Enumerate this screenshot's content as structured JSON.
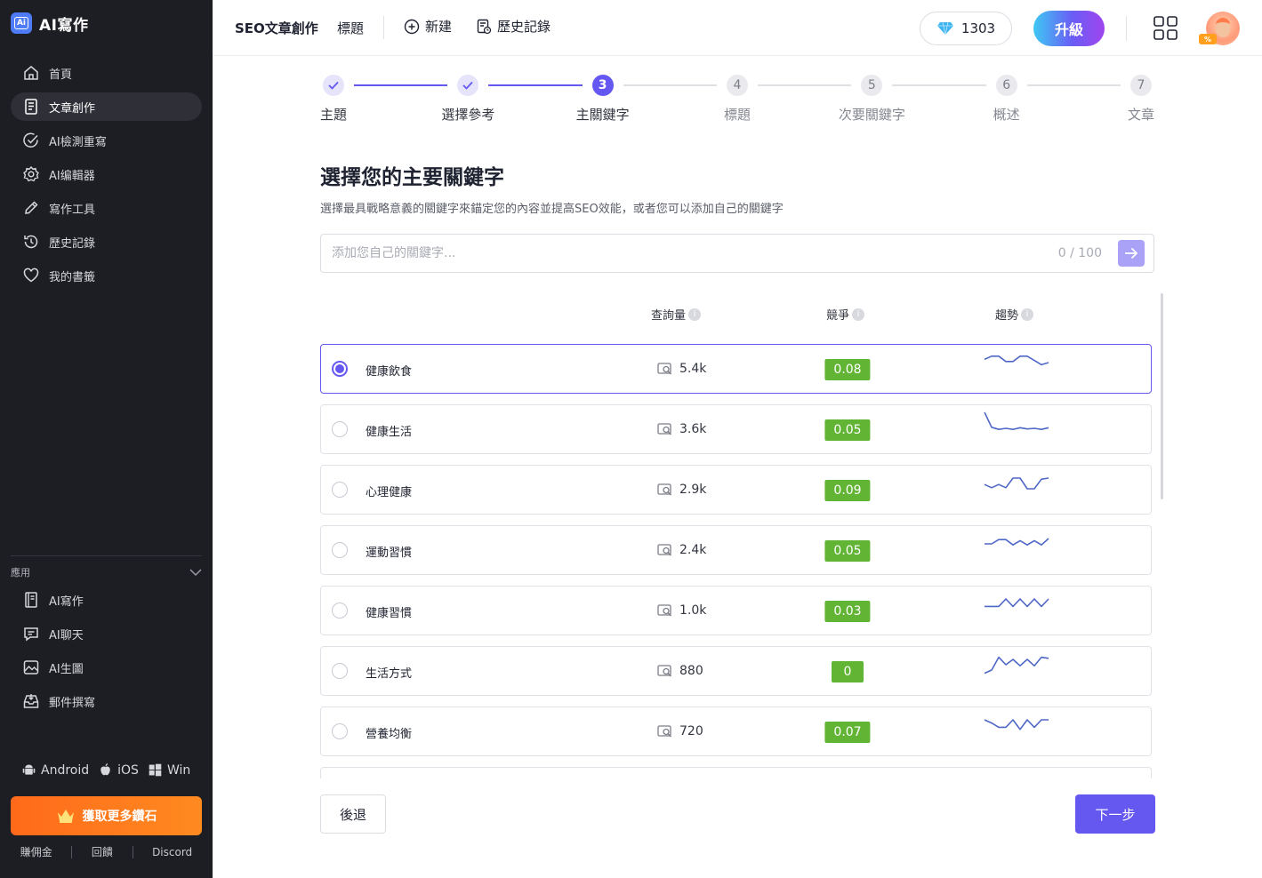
{
  "app": {
    "logo_text": "AI寫作",
    "logo_mark": "Ai"
  },
  "sidebar": {
    "items": [
      {
        "label": "首頁",
        "icon": "home-icon"
      },
      {
        "label": "文章創作",
        "icon": "document-icon",
        "active": true
      },
      {
        "label": "AI檢測重寫",
        "icon": "check-circle-icon"
      },
      {
        "label": "AI编輯器",
        "icon": "gear-icon"
      },
      {
        "label": "寫作工具",
        "icon": "pencil-icon"
      },
      {
        "label": "歷史記錄",
        "icon": "history-icon"
      },
      {
        "label": "我的書籤",
        "icon": "heart-icon"
      }
    ],
    "apps_title": "應用",
    "apps": [
      {
        "label": "AI寫作",
        "icon": "notebook-icon"
      },
      {
        "label": "AI聊天",
        "icon": "chat-icon"
      },
      {
        "label": "AI生圖",
        "icon": "image-icon"
      },
      {
        "label": "郵件撰寫",
        "icon": "inbox-icon"
      }
    ],
    "platforms": [
      "Android",
      "iOS",
      "Win"
    ],
    "get_gems_label": "獲取更多鑽石",
    "footer_links": [
      "賺佣金",
      "回饋",
      "Discord"
    ]
  },
  "topbar": {
    "title": "SEO文章創作",
    "subtitle": "標題",
    "new_label": "新建",
    "history_label": "歷史記錄",
    "gems": "1303",
    "upgrade_label": "升級",
    "avatar_badge": "%"
  },
  "stepper": {
    "steps": [
      {
        "num": "1",
        "label": "主題",
        "state": "done"
      },
      {
        "num": "2",
        "label": "選擇參考",
        "state": "done"
      },
      {
        "num": "3",
        "label": "主關鍵字",
        "state": "current"
      },
      {
        "num": "4",
        "label": "標題",
        "state": "todo"
      },
      {
        "num": "5",
        "label": "次要關鍵字",
        "state": "todo"
      },
      {
        "num": "6",
        "label": "概述",
        "state": "todo"
      },
      {
        "num": "7",
        "label": "文章",
        "state": "todo"
      }
    ]
  },
  "main": {
    "heading": "選擇您的主要關鍵字",
    "subheading": "選擇最具戰略意義的關鍵字來錨定您的內容並提高SEO效能，或者您可以添加自己的關鍵字",
    "input_placeholder": "添加您自己的關鍵字...",
    "input_value": "",
    "char_count": "0 / 100",
    "col_volume": "查詢量",
    "col_competition": "競爭",
    "col_trend": "趨勢",
    "info_glyph": "i",
    "keywords": [
      {
        "keyword": "健康飲食",
        "volume": "5.4k",
        "competition": "0.08",
        "selected": true,
        "trend": [
          0.65,
          0.8,
          0.8,
          0.55,
          0.55,
          0.8,
          0.8,
          0.6,
          0.4,
          0.5
        ]
      },
      {
        "keyword": "健康生活",
        "volume": "3.6k",
        "competition": "0.05",
        "selected": false,
        "trend": [
          1.0,
          0.3,
          0.2,
          0.25,
          0.2,
          0.28,
          0.22,
          0.25,
          0.2,
          0.28
        ]
      },
      {
        "keyword": "心理健康",
        "volume": "2.9k",
        "competition": "0.09",
        "selected": false,
        "trend": [
          0.45,
          0.3,
          0.45,
          0.3,
          0.75,
          0.75,
          0.25,
          0.25,
          0.7,
          0.75
        ]
      },
      {
        "keyword": "運動習慣",
        "volume": "2.4k",
        "competition": "0.05",
        "selected": false,
        "trend": [
          0.5,
          0.5,
          0.7,
          0.7,
          0.45,
          0.65,
          0.45,
          0.65,
          0.45,
          0.75
        ]
      },
      {
        "keyword": "健康習慣",
        "volume": "1.0k",
        "competition": "0.03",
        "selected": false,
        "trend": [
          0.4,
          0.4,
          0.4,
          0.75,
          0.4,
          0.75,
          0.4,
          0.75,
          0.4,
          0.75
        ]
      },
      {
        "keyword": "生活方式",
        "volume": "880",
        "competition": "0",
        "selected": false,
        "trend": [
          0.1,
          0.25,
          0.85,
          0.5,
          0.75,
          0.45,
          0.75,
          0.45,
          0.85,
          0.8
        ]
      },
      {
        "keyword": "營養均衡",
        "volume": "720",
        "competition": "0.07",
        "selected": false,
        "trend": [
          0.75,
          0.6,
          0.4,
          0.4,
          0.75,
          0.3,
          0.75,
          0.4,
          0.75,
          0.75
        ]
      }
    ],
    "back_label": "後退",
    "next_label": "下一步"
  },
  "colors": {
    "accent": "#6558f0",
    "competition_good": "#62b534",
    "sidebar_bg": "#1d1e24",
    "gem_orange": "#ff7a1a"
  }
}
